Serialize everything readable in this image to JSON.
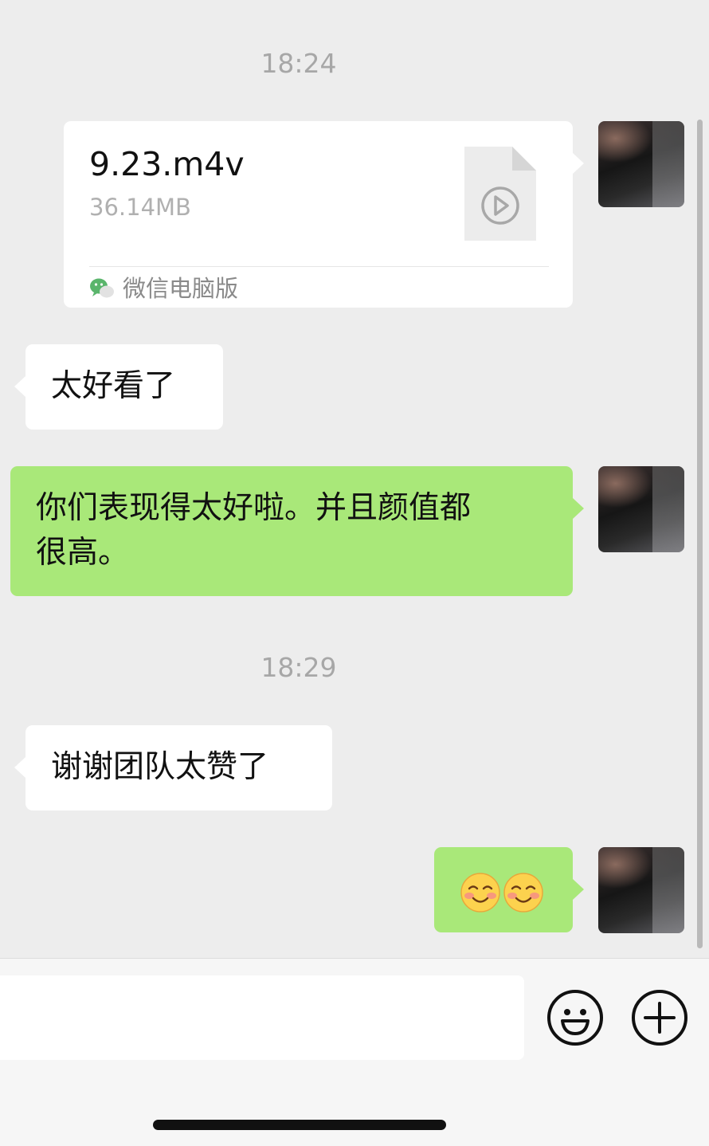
{
  "messages": {
    "time1": "18:24",
    "file": {
      "name": "9.23.m4v",
      "size": "36.14MB",
      "source": "微信电脑版"
    },
    "msg1": "太好看了",
    "msg2_line1": "你们表现得太好啦。并且颜值都",
    "msg2_line2": "很高。",
    "time2": "18:29",
    "msg3": "谢谢团队太赞了",
    "msg4_emojis": [
      "smiling-blush-emoji",
      "smiling-blush-emoji"
    ]
  },
  "input_bar": {
    "text_value": "",
    "emoji_button_icon": "smiley-icon",
    "more_button_icon": "plus-circle-icon"
  },
  "colors": {
    "background": "#ededed",
    "sent_bubble": "#a9e879",
    "received_bubble": "#ffffff",
    "timestamp": "#a7a7a7"
  }
}
